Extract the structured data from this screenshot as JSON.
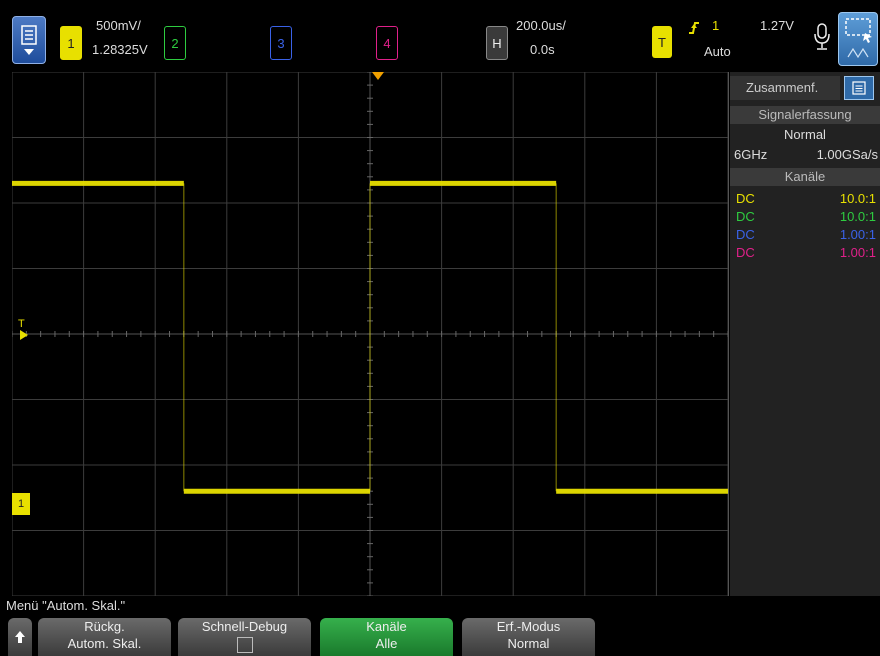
{
  "header": {
    "ch1": {
      "number": "1",
      "scale": "500mV/",
      "offset": "1.28325V"
    },
    "ch2": {
      "number": "2"
    },
    "ch3": {
      "number": "3"
    },
    "ch4": {
      "number": "4"
    },
    "horizontal": {
      "label": "H",
      "timebase": "200.0us/",
      "delay": "0.0s"
    },
    "trigger": {
      "label": "T",
      "source": "1",
      "level": "1.27V",
      "mode": "Auto"
    }
  },
  "colors": {
    "ch1": "#e8e000",
    "ch2": "#2ecc40",
    "ch3": "#3a62e8",
    "ch4": "#e0208a"
  },
  "side_panel": {
    "tab": "Zusammenf.",
    "acq_header": "Signalerfassung",
    "acq_mode": "Normal",
    "bandwidth": "6GHz",
    "sample_rate": "1.00GSa/s",
    "channels_header": "Kanäle",
    "channels": [
      {
        "coupling": "DC",
        "probe": "10.0:1"
      },
      {
        "coupling": "DC",
        "probe": "10.0:1"
      },
      {
        "coupling": "DC",
        "probe": "1.00:1"
      },
      {
        "coupling": "DC",
        "probe": "1.00:1"
      }
    ]
  },
  "markers": {
    "trigger_level": "T",
    "ground_ch1": "1"
  },
  "waveform": {
    "type": "square",
    "levels_div": [
      2.3,
      -2.4
    ],
    "transitions_div": [
      -2.6,
      0.0,
      2.6
    ]
  },
  "bottom": {
    "menu_title": "Menü \"Autom. Skal.\"",
    "softkeys": [
      {
        "line1": "Rückg.",
        "line2": "Autom. Skal."
      },
      {
        "line1": "Schnell-Debug",
        "line2": ""
      },
      {
        "line1": "Kanäle",
        "line2": "Alle"
      },
      {
        "line1": "Erf.-Modus",
        "line2": "Normal"
      }
    ]
  }
}
